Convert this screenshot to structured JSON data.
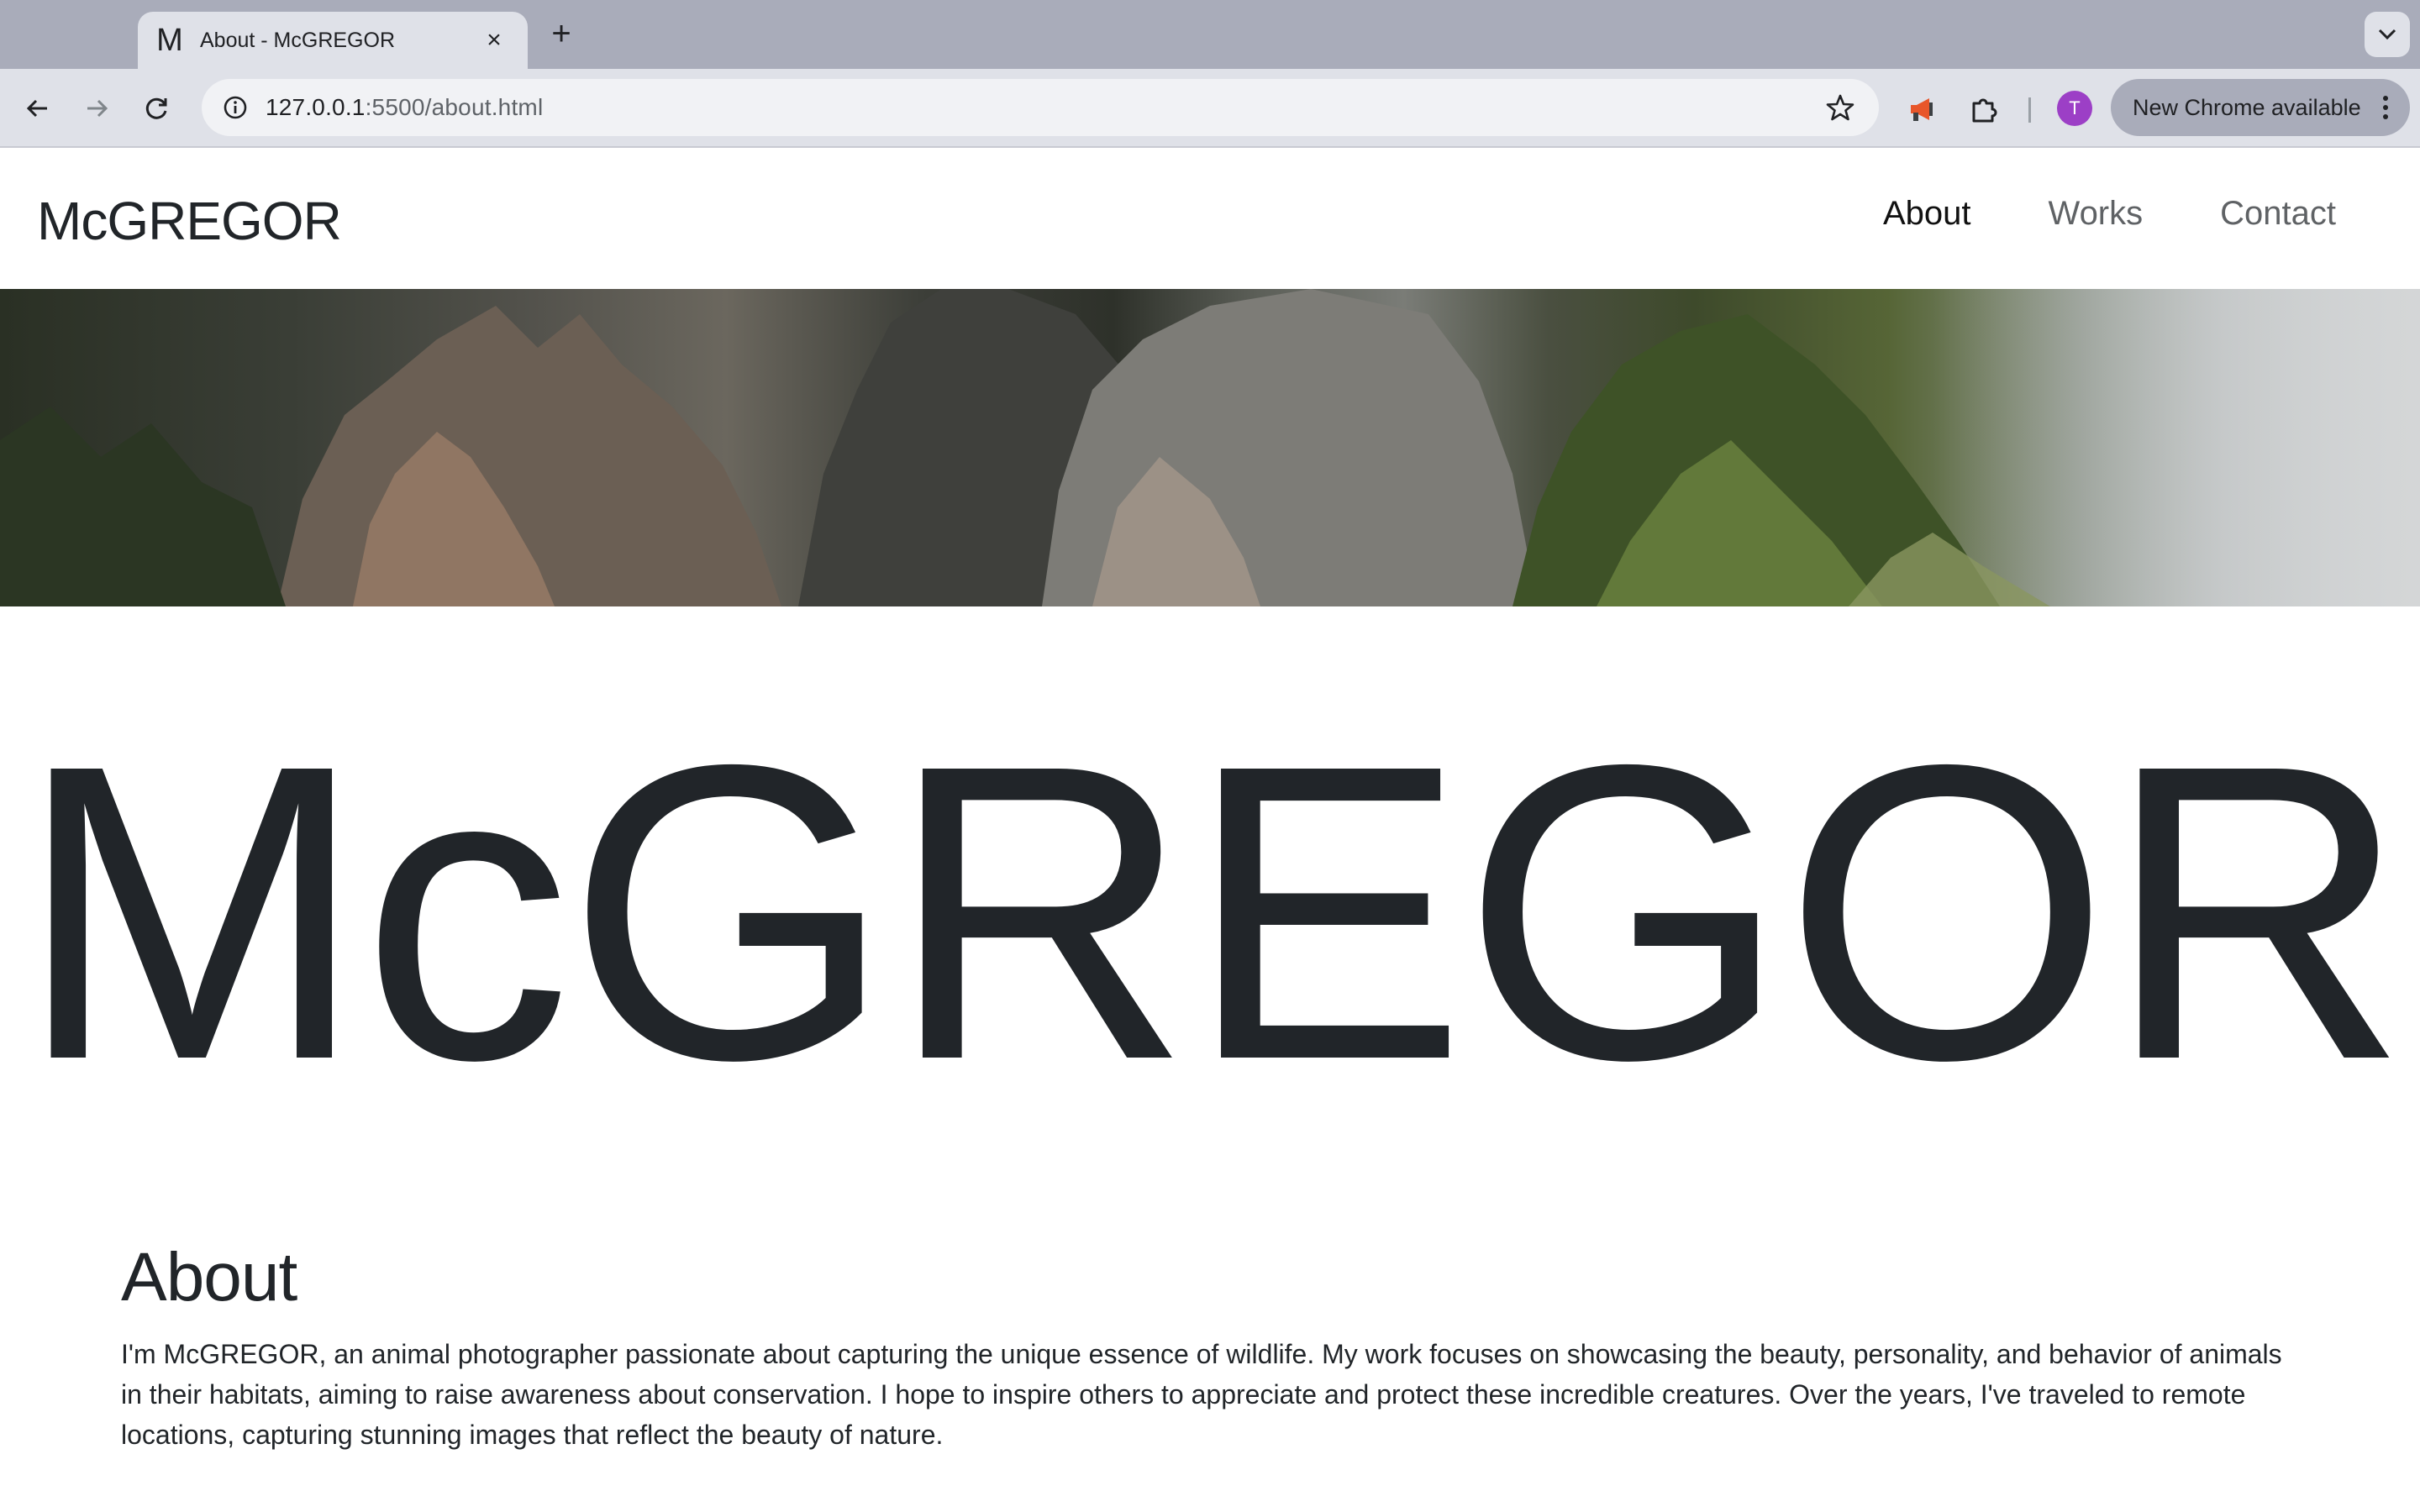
{
  "browser": {
    "tab": {
      "favicon_letter": "M",
      "title": "About - McGREGOR",
      "close_symbol": "×"
    },
    "new_tab_symbol": "+",
    "url_host": "127.0.0.1",
    "url_rest": ":5500/about.html",
    "avatar_letter": "T",
    "update_label": "New Chrome available"
  },
  "site": {
    "brand": "McGREGOR",
    "nav": [
      {
        "label": "About",
        "active": true
      },
      {
        "label": "Works",
        "active": false
      },
      {
        "label": "Contact",
        "active": false
      }
    ],
    "hero_title": "McGREGOR",
    "about_heading": "About",
    "about_text": "I'm McGREGOR, an animal photographer passionate about capturing the unique essence of wildlife. My work focuses on showcasing the beauty, personality, and behavior of animals in their habitats, aiming to raise awareness about conservation. I hope to inspire others to appreciate and protect these incredible creatures. Over the years, I've traveled to remote locations, capturing stunning images that reflect the beauty of nature."
  },
  "colors": {
    "text": "#212529",
    "tabbar": "#a9acba",
    "toolbar": "#dfe1e8",
    "avatar": "#9c3fc6"
  }
}
